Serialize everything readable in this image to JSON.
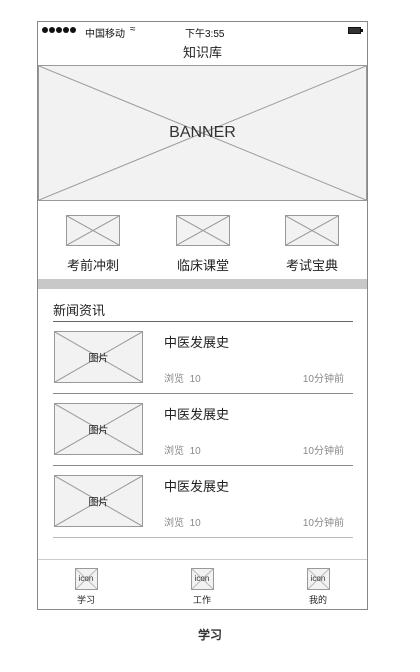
{
  "status_bar": {
    "carrier": "中国移动",
    "time": "下午3:55",
    "wifi_icon": "wifi-icon",
    "battery_icon": "battery-icon"
  },
  "nav": {
    "title": "知识库"
  },
  "banner": {
    "label": "BANNER"
  },
  "categories": [
    {
      "label": "考前冲刺",
      "icon": "placeholder-image-icon"
    },
    {
      "label": "临床课堂",
      "icon": "placeholder-image-icon"
    },
    {
      "label": "考试宝典",
      "icon": "placeholder-image-icon"
    }
  ],
  "news": {
    "heading": "新闻资讯",
    "items": [
      {
        "thumb_label": "图片",
        "title": "中医发展史",
        "views_label": "浏览",
        "views": "10",
        "time": "10分钟前"
      },
      {
        "thumb_label": "图片",
        "title": "中医发展史",
        "views_label": "浏览",
        "views": "10",
        "time": "10分钟前"
      },
      {
        "thumb_label": "图片",
        "title": "中医发展史",
        "views_label": "浏览",
        "views": "10",
        "time": "10分钟前"
      }
    ]
  },
  "tabbar": {
    "tabs": [
      {
        "icon_text": "icon",
        "label": "学习"
      },
      {
        "icon_text": "icon",
        "label": "工作"
      },
      {
        "icon_text": "icon",
        "label": "我的"
      }
    ]
  },
  "caption": "学习",
  "colors": {
    "placeholder_fill": "#f2f2f2",
    "placeholder_stroke": "#999999",
    "divider_band": "#c8c8c8"
  }
}
